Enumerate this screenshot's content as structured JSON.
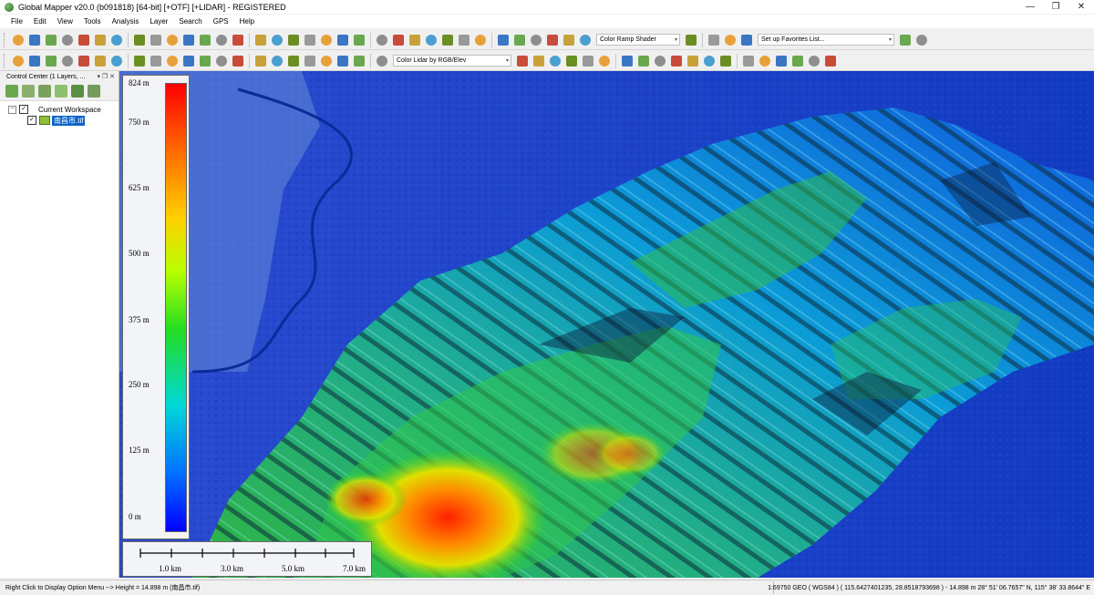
{
  "window": {
    "title": "Global Mapper v20.0 (b091818) [64-bit] [+OTF] [+LIDAR] - REGISTERED",
    "minimize": "—",
    "restore": "❐",
    "close": "✕"
  },
  "menu": [
    "File",
    "Edit",
    "View",
    "Tools",
    "Analysis",
    "Layer",
    "Search",
    "GPS",
    "Help"
  ],
  "toolbar": {
    "shader_select": "Color Ramp Shader",
    "favorites_select": "Set up Favorites List...",
    "lidar_color_select": "Color Lidar by RGB/Elev"
  },
  "control_center": {
    "title": "Control Center (1 Layers, ...",
    "workspace": "Current Workspace",
    "layer": "南昌市.tif",
    "checked": "✓"
  },
  "legend": {
    "labels": [
      "824 m",
      "750 m",
      "625 m",
      "500 m",
      "375 m",
      "250 m",
      "125 m",
      "0 m"
    ],
    "colors": [
      "#ff0000",
      "#ff6a00",
      "#ffd000",
      "#b7ff00",
      "#22dd22",
      "#00d8d8",
      "#0070ff",
      "#0000ff"
    ]
  },
  "scale": {
    "labels": [
      "1.0 km",
      "3.0 km",
      "5.0 km",
      "7.0 km"
    ]
  },
  "status": {
    "left": "Right Click to Display Option Menu --> Height = 14.898 m (南昌市.tif)",
    "right": "1:69750  GEO ( WGS84 ) ( 115.6427401235, 28.8518793698 ) - 14.898 m  28° 51' 06.7657\" N, 115° 38' 33.8644\" E"
  },
  "icons": {
    "toolbar1": [
      "open-icon",
      "globe-icon",
      "save-icon",
      "print-icon",
      "wrench-icon",
      "layers-icon",
      "overview-icon",
      "zoom-box-icon",
      "pan-icon",
      "zoom-in-icon",
      "zoom-out-icon",
      "back-icon",
      "home-icon",
      "edit-pencil-icon",
      "select-icon",
      "delete-icon",
      "measure-icon",
      "info-icon",
      "search-icon",
      "terrain-icon",
      "terrain2-icon",
      "terrain3-icon",
      "terrain4-icon",
      "flag-icon",
      "sun-icon",
      "image-icon",
      "cross-icon",
      "grid-icon",
      "path-icon",
      "cube-icon",
      "chart-icon",
      "elev-icon",
      "elev2-icon",
      "contour-icon",
      "mountain-icon",
      "shader-icon",
      "globe2-icon",
      "gear-icon",
      "moon-icon",
      "star-icon"
    ],
    "toolbar2": [
      "line-tool-icon",
      "line2-icon",
      "line3-icon",
      "line4-icon",
      "line5-icon",
      "digitize-icon",
      "circle-icon",
      "line6-icon",
      "line7-icon",
      "line8-icon",
      "edit-icon",
      "move-icon",
      "vertex-icon",
      "vertex2-icon",
      "move2-icon",
      "cut-icon",
      "snap-icon",
      "snap2-icon",
      "snap3-icon",
      "snap4-icon",
      "snap5-icon",
      "ruler-icon",
      "lidar1-icon",
      "lidar2-icon",
      "lidar3-icon",
      "lidar4-icon",
      "triangle-icon",
      "class-icon",
      "class2-icon",
      "filter-icon",
      "filter2-icon",
      "class3-icon",
      "peak-icon",
      "tree-icon",
      "ground-icon",
      "tree2-icon",
      "building-icon",
      "wire-icon",
      "water-icon",
      "pole-icon",
      "key-icon"
    ]
  }
}
